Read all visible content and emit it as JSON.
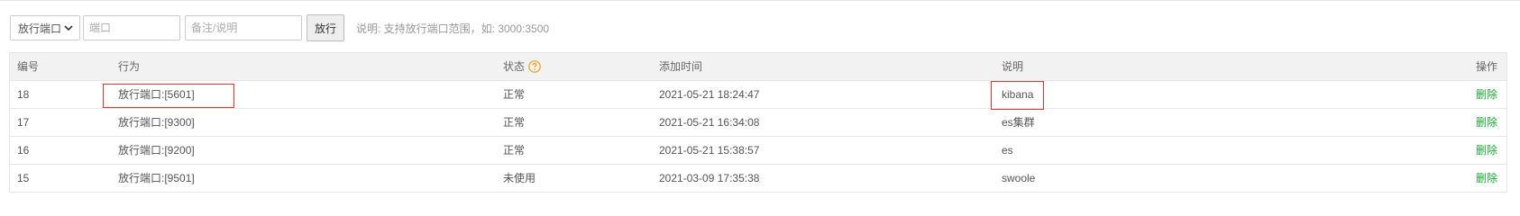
{
  "toolbar": {
    "select_value": "放行端口",
    "port_placeholder": "端口",
    "note_placeholder": "备注/说明",
    "submit_label": "放行",
    "hint": "说明: 支持放行端口范围，如: 3000:3500"
  },
  "table": {
    "headers": {
      "id": "编号",
      "action": "行为",
      "status": "状态",
      "time": "添加时间",
      "note": "说明",
      "op": "操作"
    },
    "rows": [
      {
        "id": "18",
        "action": "放行端口:[5601]",
        "status": "正常",
        "time": "2021-05-21 18:24:47",
        "note": "kibana",
        "op": "删除"
      },
      {
        "id": "17",
        "action": "放行端口:[9300]",
        "status": "正常",
        "time": "2021-05-21 16:34:08",
        "note": "es集群",
        "op": "删除"
      },
      {
        "id": "16",
        "action": "放行端口:[9200]",
        "status": "正常",
        "time": "2021-05-21 15:38:57",
        "note": "es",
        "op": "删除"
      },
      {
        "id": "15",
        "action": "放行端口:[9501]",
        "status": "未使用",
        "time": "2021-03-09 17:35:38",
        "note": "swoole",
        "op": "删除"
      }
    ]
  },
  "colors": {
    "accent_green": "#20a53a",
    "help_orange": "#f39c12",
    "annotation_red": "#e63434"
  },
  "icons": {
    "select_caret": "chevron-down-icon",
    "status_help": "question-circle-icon"
  }
}
